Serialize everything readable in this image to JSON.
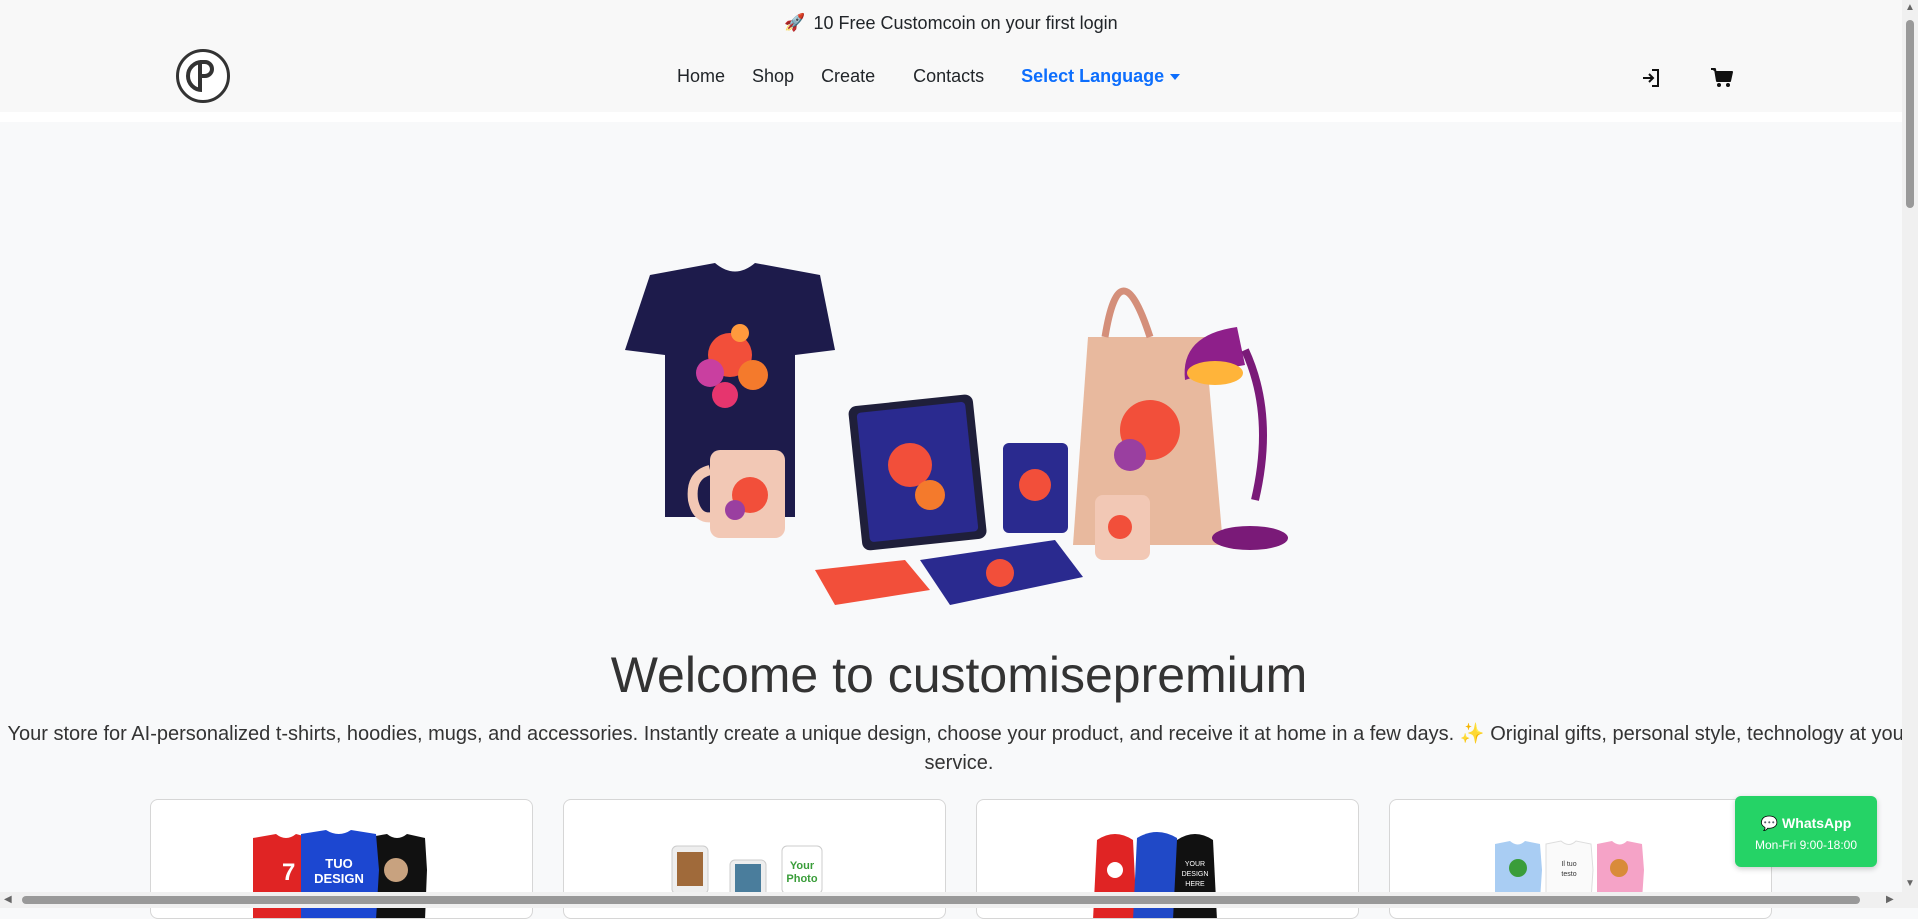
{
  "promo": {
    "icon": "rocket-icon",
    "text": "10 Free Customcoin on your first login"
  },
  "nav": {
    "items": [
      "Home",
      "Shop",
      "Create",
      "Contacts"
    ],
    "language": "Select Language",
    "login_icon": "login-icon",
    "cart_icon": "cart-icon"
  },
  "hero": {
    "title": "Welcome to customisepremium",
    "intro": "Your store for AI-personalized t-shirts, hoodies, mugs, and accessories. Instantly create a unique design, choose your product, and receive it at home in a few days. ✨ Original gifts, personal style, technology at your",
    "intro_end": "service."
  },
  "cards": [
    {
      "name": "tshirts",
      "labels": [
        "7",
        "TUO",
        "DESIGN"
      ]
    },
    {
      "name": "mugs",
      "labels": [
        "Your",
        "Photo"
      ]
    },
    {
      "name": "hoodies",
      "labels": [
        "YOUR",
        "DESIGN",
        "HERE"
      ]
    },
    {
      "name": "kids",
      "labels": [
        "Il tuo",
        "testo"
      ]
    }
  ],
  "whatsapp": {
    "title": "WhatsApp",
    "hours": "Mon-Fri 9:00-18:00"
  },
  "colors": {
    "accent": "#0d6efd",
    "whatsapp": "#25d366"
  }
}
